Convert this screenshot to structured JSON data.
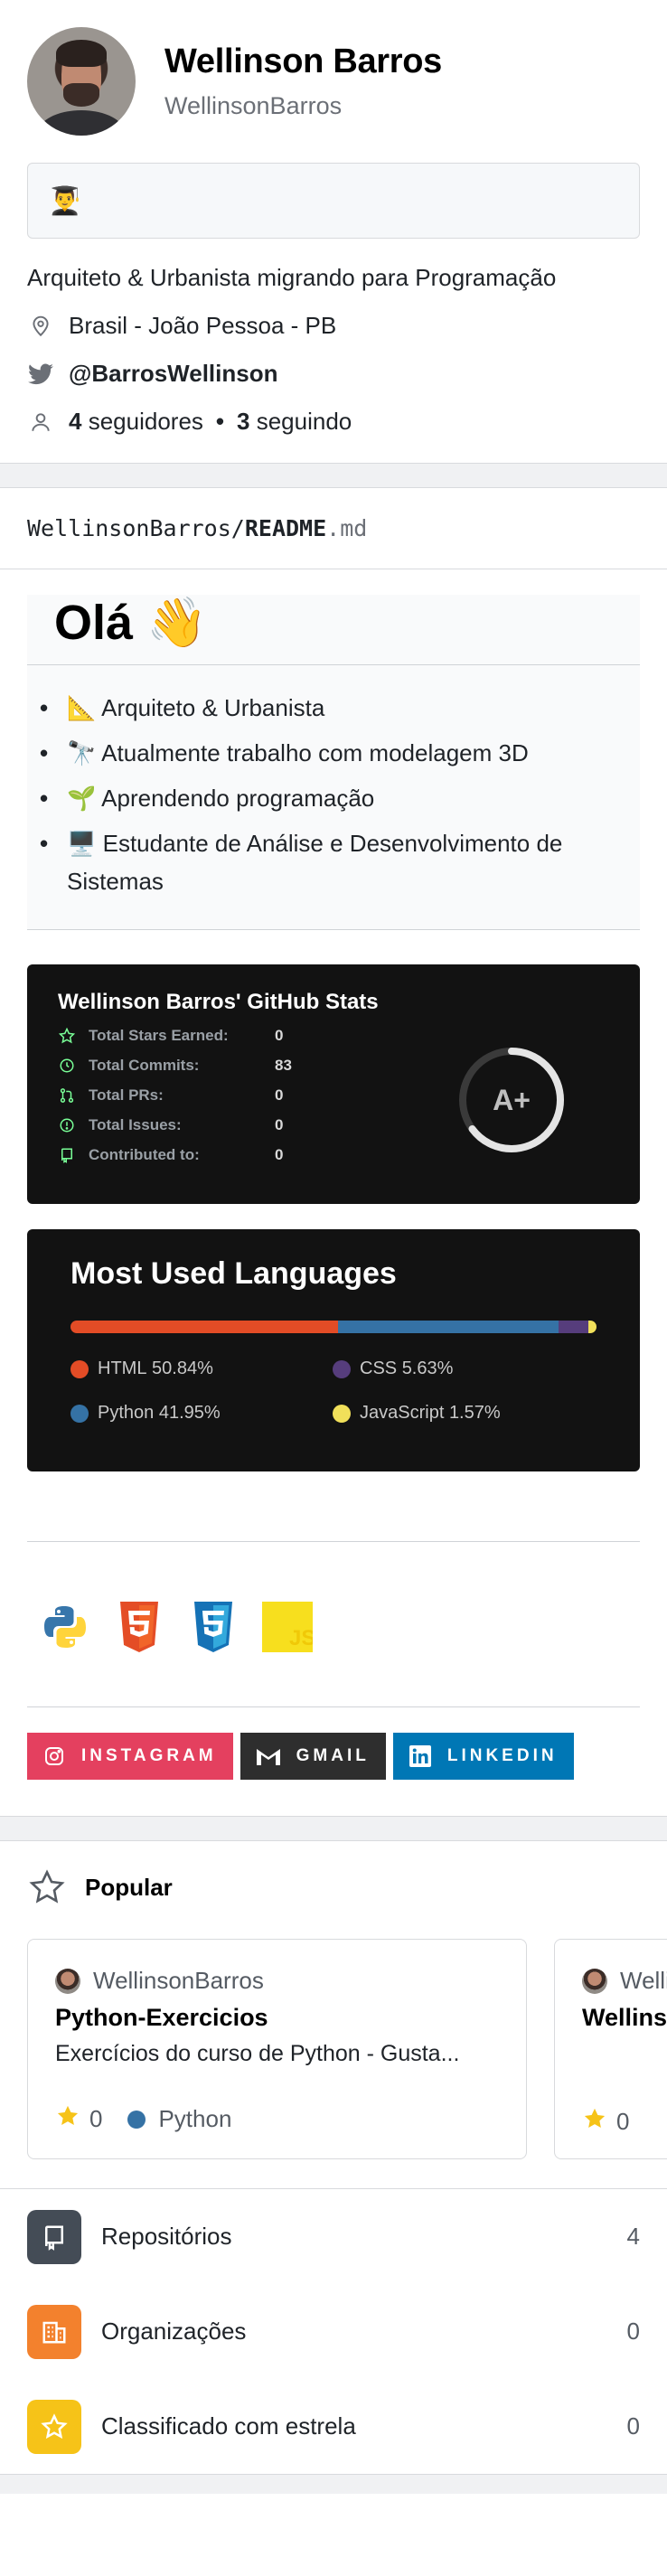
{
  "profile": {
    "full_name": "Wellinson Barros",
    "username": "WellinsonBarros",
    "status_emoji": "👨‍🎓",
    "bio": "Arquiteto & Urbanista migrando para Programação",
    "location": "Brasil - João Pessoa - PB",
    "twitter": "@BarrosWellinson",
    "followers_count": "4",
    "followers_label": "seguidores",
    "following_count": "3",
    "following_label": "seguindo"
  },
  "readme": {
    "path_owner": "WellinsonBarros",
    "path_sep": "/",
    "path_file": "README",
    "path_ext": ".md",
    "greeting": "Olá 👋",
    "bullets": [
      "📐 Arquiteto & Urbanista",
      "🔭 Atualmente trabalho com modelagem 3D",
      "🌱 Aprendendo programação",
      "🖥️ Estudante de Análise e Desenvolvimento de Sistemas"
    ],
    "stats": {
      "title": "Wellinson Barros' GitHub Stats",
      "rows": [
        {
          "label": "Total Stars Earned:",
          "value": "0",
          "icon": "star-icon"
        },
        {
          "label": "Total Commits:",
          "value": "83",
          "icon": "history-icon"
        },
        {
          "label": "Total PRs:",
          "value": "0",
          "icon": "pull-request-icon"
        },
        {
          "label": "Total Issues:",
          "value": "0",
          "icon": "issue-icon"
        },
        {
          "label": "Contributed to:",
          "value": "0",
          "icon": "repo-icon"
        }
      ],
      "grade": "A+",
      "accent": "#79ff97",
      "ring_color": "#e4e4e4"
    },
    "languages": {
      "title": "Most Used Languages",
      "items": [
        {
          "name": "HTML",
          "percent": "50.84%",
          "value": 50.84,
          "color": "#e34c26"
        },
        {
          "name": "CSS",
          "percent": "5.63%",
          "value": 5.63,
          "color": "#563d7c"
        },
        {
          "name": "Python",
          "percent": "41.95%",
          "value": 41.95,
          "color": "#3572A5"
        },
        {
          "name": "JavaScript",
          "percent": "1.57%",
          "value": 1.57,
          "color": "#f1e05a"
        }
      ]
    },
    "tech_icons": [
      "python-icon",
      "html5-icon",
      "css3-icon",
      "javascript-icon"
    ],
    "badges": [
      {
        "label": "INSTAGRAM",
        "color": "#E4405F",
        "icon": "instagram-icon"
      },
      {
        "label": "GMAIL",
        "color": "#2e2e2e",
        "icon": "gmail-icon"
      },
      {
        "label": "LINKEDIN",
        "color": "#0077B5",
        "icon": "linkedin-icon"
      }
    ]
  },
  "popular": {
    "title": "Popular",
    "repos": [
      {
        "owner": "WellinsonBarros",
        "name": "Python-Exercicios",
        "description": "Exercícios do curso de Python - Gusta...",
        "stars": "0",
        "language": "Python",
        "language_color": "#3572A5"
      },
      {
        "owner": "WellinsonBarros",
        "name": "WellinsonBarros",
        "description": "",
        "stars": "0",
        "language": "",
        "language_color": ""
      }
    ]
  },
  "summary": [
    {
      "label": "Repositórios",
      "count": "4",
      "color": "#444c56",
      "icon": "repo-icon"
    },
    {
      "label": "Organizações",
      "count": "0",
      "color": "#f3812d",
      "icon": "organization-icon"
    },
    {
      "label": "Classificado com estrela",
      "count": "0",
      "color": "#f6c318",
      "icon": "star-icon"
    }
  ]
}
